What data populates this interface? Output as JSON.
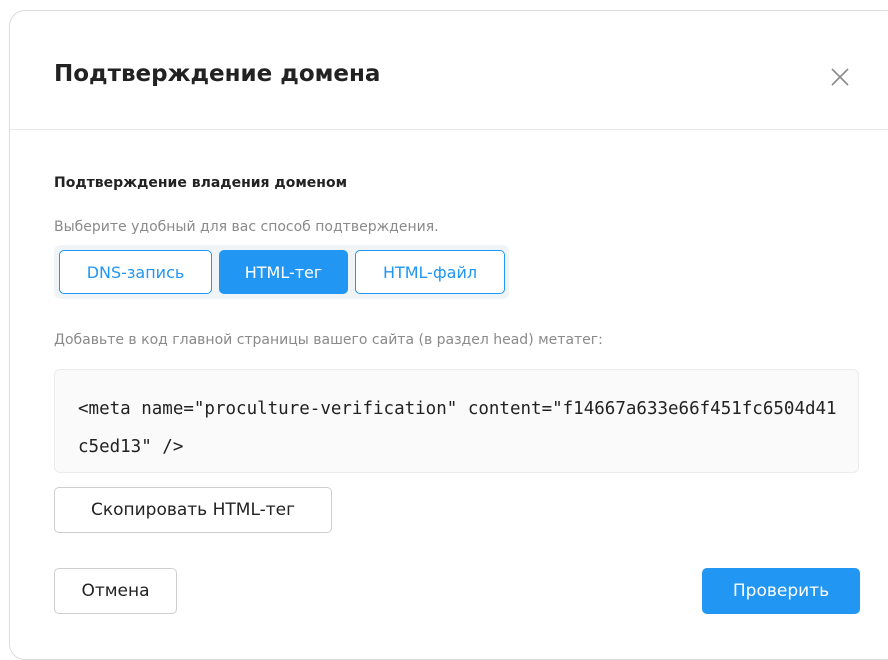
{
  "modal": {
    "title": "Подтверждение домена",
    "close_icon": "close-icon"
  },
  "section": {
    "title": "Подтверждение владения доменом",
    "hint": "Выберите удобный для вас способ подтверждения."
  },
  "methods": [
    {
      "label": "DNS-запись",
      "active": false
    },
    {
      "label": "HTML-тег",
      "active": true
    },
    {
      "label": "HTML-файл",
      "active": false
    }
  ],
  "instruction": "Добавьте в код главной страницы вашего сайта (в раздел head) метатег:",
  "code": "<meta name=\"proculture-verification\" content=\"f14667a633e66f451fc6504d41c5ed13\" />",
  "buttons": {
    "copy": "Скопировать HTML-тег",
    "cancel": "Отмена",
    "verify": "Проверить"
  },
  "colors": {
    "accent": "#2196f3",
    "text": "#222222",
    "muted": "#8a8a8a"
  }
}
